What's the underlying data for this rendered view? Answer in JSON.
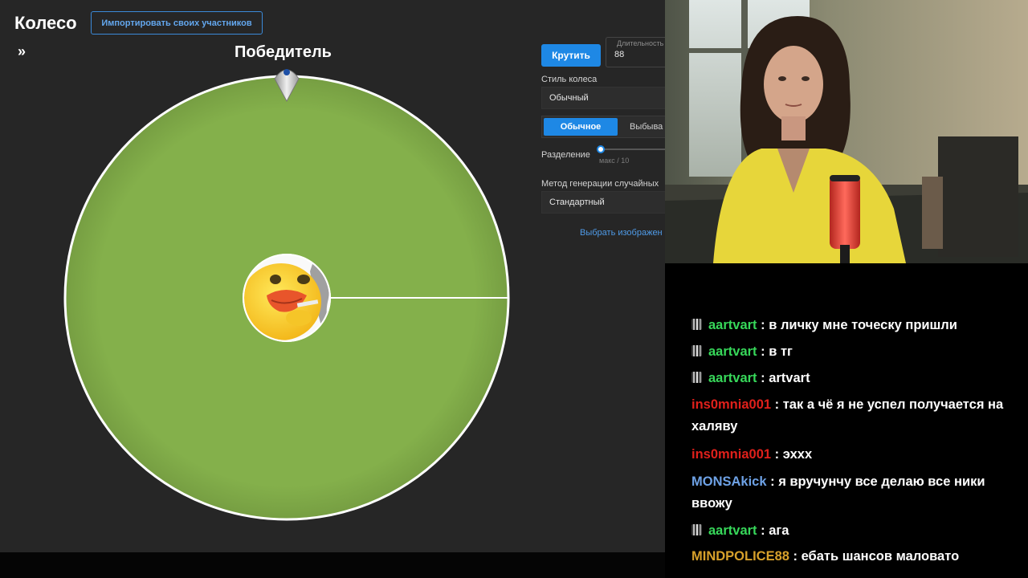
{
  "app": {
    "title": "Колесо",
    "import_button": "Импортировать своих участников",
    "expand_icon": "»",
    "winner_label": "Победитель"
  },
  "controls": {
    "spin_button": "Крутить",
    "duration_label": "Длительность",
    "duration_value": "88",
    "wheel_style_label": "Стиль колеса",
    "wheel_style_value": "Обычный",
    "mode_active": "Обычное",
    "mode_other": "Выбыва",
    "split_label": "Разделение",
    "split_hint": "макс / 10",
    "split_value": 0,
    "random_method_label": "Метод генерации случайных",
    "random_method_value": "Стандартный",
    "image_link": "Выбрать изображен"
  },
  "wheel": {
    "segment_color": "#84b04b",
    "border_color": "#ffffff",
    "center_image": "duck-sticker-icon"
  },
  "chat": {
    "messages": [
      {
        "badge": true,
        "user": "aartvart",
        "color": "green",
        "text": ": в личку мне точеску пришли"
      },
      {
        "badge": true,
        "user": "aartvart",
        "color": "green",
        "text": ": в тг"
      },
      {
        "badge": true,
        "user": "aartvart",
        "color": "green",
        "text": ": artvart"
      },
      {
        "badge": false,
        "user": "ins0mnia001",
        "color": "red",
        "text": ": так а чё я не успел получается на халяву"
      },
      {
        "badge": false,
        "user": "ins0mnia001",
        "color": "red",
        "text": ": эххх"
      },
      {
        "badge": false,
        "user": "MONSAkick",
        "color": "blue",
        "text": ": я вручунчу все делаю все ники ввожу"
      },
      {
        "badge": true,
        "user": "aartvart",
        "color": "green",
        "text": ": ага"
      },
      {
        "badge": false,
        "user": "MINDPOLICE88",
        "color": "gold",
        "text": ": ебать шансов маловато"
      }
    ]
  }
}
